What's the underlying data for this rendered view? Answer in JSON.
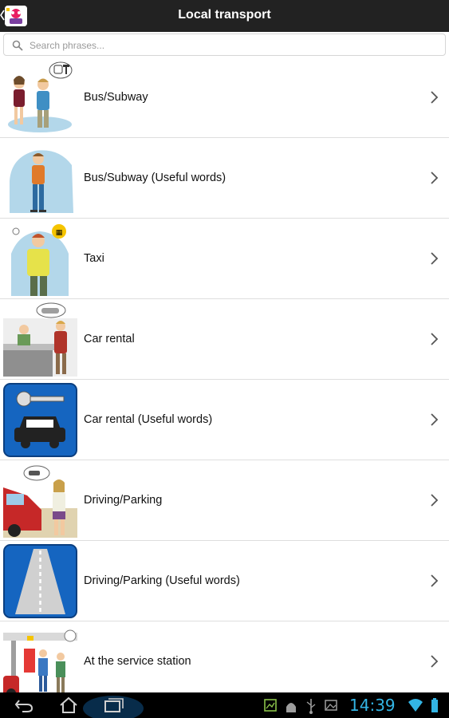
{
  "header": {
    "title": "Local transport",
    "icon": "phrasebook-app-icon"
  },
  "search": {
    "placeholder": "Search phrases..."
  },
  "list": {
    "items": [
      {
        "label": "Bus/Subway",
        "icon": "bus-subway-illustration"
      },
      {
        "label": "Bus/Subway (Useful words)",
        "icon": "man-standing-illustration"
      },
      {
        "label": "Taxi",
        "icon": "taxi-illustration"
      },
      {
        "label": "Car rental",
        "icon": "car-rental-desk-illustration"
      },
      {
        "label": "Car rental (Useful words)",
        "icon": "car-key-icon"
      },
      {
        "label": "Driving/Parking",
        "icon": "driving-parking-illustration"
      },
      {
        "label": "Driving/Parking (Useful words)",
        "icon": "road-icon"
      },
      {
        "label": "At the service station",
        "icon": "service-station-illustration"
      }
    ]
  },
  "statusbar": {
    "time": "14:39",
    "accent": "#33b5e5"
  },
  "colors": {
    "titlebar": "#222222",
    "icon_tile_blue": "#1565c0"
  }
}
